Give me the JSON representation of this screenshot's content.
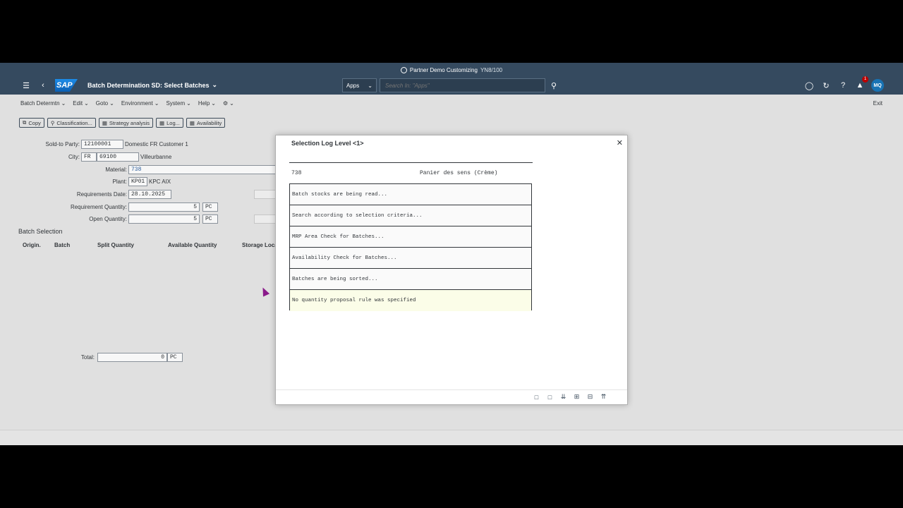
{
  "titlebar": {
    "title": "Partner Demo Customizing",
    "system": "YN8/100"
  },
  "shell": {
    "app_title": "Batch Determination SD: Select Batches",
    "logo": "SAP",
    "apps_label": "Apps",
    "search_placeholder": "Search In: \"Apps\"",
    "notif_count": "1",
    "avatar": "MQ"
  },
  "menu": {
    "items": [
      "Batch Determtn",
      "Edit",
      "Goto",
      "Environment",
      "System",
      "Help"
    ],
    "exit": "Exit"
  },
  "toolbar": {
    "copy": "Copy",
    "classification": "Classification...",
    "strategy": "Strategy analysis",
    "log": "Log...",
    "availability": "Availability"
  },
  "form": {
    "sold_to_label": "Sold-to Party:",
    "sold_to_value": "12100001",
    "sold_to_name": "Domestic FR Customer 1",
    "city_label": "City:",
    "country": "FR",
    "postal": "69100",
    "city_name": "Villeurbanne",
    "material_label": "Material:",
    "material_value": "738",
    "plant_label": "Plant:",
    "plant_value": "KP01",
    "plant_name": "KPC AIX",
    "req_date_label": "Requirements Date:",
    "req_date_value": "28.10.2025",
    "req_qty_label": "Requirement Quantity:",
    "req_qty_value": "5",
    "req_qty_unit": "PC",
    "open_qty_label": "Open Quantity:",
    "open_qty_value": "5",
    "open_qty_unit": "PC"
  },
  "batch_selection": {
    "title": "Batch Selection",
    "columns": [
      "Origin.",
      "Batch",
      "Split Quantity",
      "Available Quantity",
      "Storage Loca"
    ],
    "total_label": "Total:",
    "total_value": "0",
    "total_unit": "PC"
  },
  "dialog": {
    "title": "Selection Log Level <1>",
    "material": "738",
    "material_desc": "Panier des sens (Crème)",
    "log_lines": [
      "Batch stocks are being read...",
      "Search according to selection criteria...",
      "MRP Area Check for Batches...",
      "Availability Check for Batches...",
      "Batches are being sorted...",
      "No quantity proposal rule was specified"
    ]
  }
}
